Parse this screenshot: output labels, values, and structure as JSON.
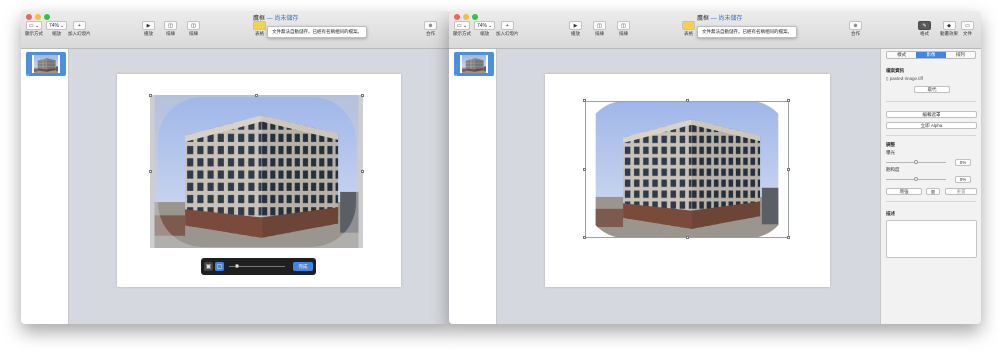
{
  "toolbar": {
    "view_label": "顯示方式",
    "zoom_value": "74%",
    "zoom_label": "縮放",
    "add_slide_label": "加入幻燈片",
    "play_label": "播放",
    "keynote_live_label": "排練",
    "table_label": "表格",
    "collaborate_label": "合作"
  },
  "window1": {
    "title": "鷹框",
    "title_status": "— 尚未儲存",
    "tooltip": "文件無法自動儲存。已經有名稱相同的檔案。",
    "mask_done": "完成"
  },
  "window2": {
    "title": "鷹框",
    "title_status": "— 尚未儲存",
    "tooltip": "文件無法自動儲存。已經有名稱相同的檔案。",
    "format_label": "格式",
    "animate_label": "動畫效果",
    "document_label": "文件"
  },
  "navigator": {
    "slide_number": "1"
  },
  "inspector": {
    "tabs": [
      "樣式",
      "影像",
      "排列"
    ],
    "active_tab": "影像",
    "file_info_title": "檔案資訊",
    "file_name": "pasted-image.tiff",
    "replace_button": "取代",
    "edit_mask_button": "編輯遮罩",
    "instant_alpha_button": "立即 Alpha",
    "adjust_title": "調整",
    "exposure_label": "曝光",
    "exposure_value": "0%",
    "saturation_label": "飽和度",
    "saturation_value": "0%",
    "enhance_button": "增強",
    "reset_button": "重置",
    "description_title": "描述"
  }
}
